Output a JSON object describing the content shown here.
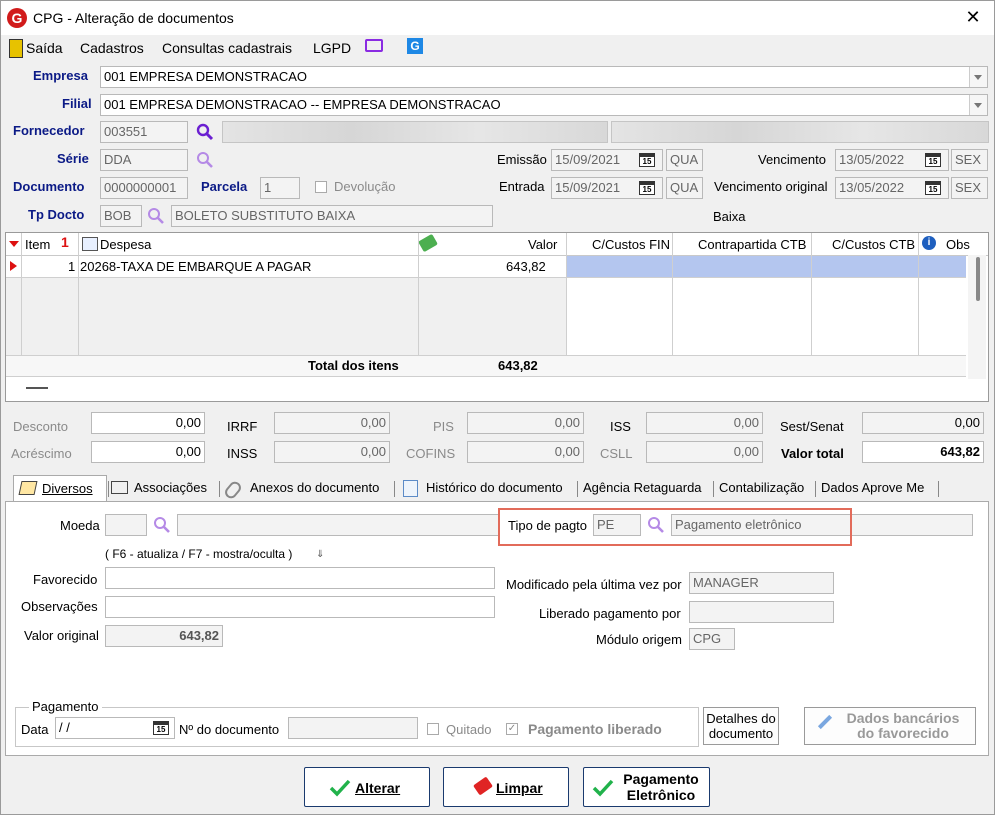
{
  "window": {
    "title": "CPG - Alteração de documentos",
    "logo_letter": "G"
  },
  "menu": {
    "items": [
      "Saída",
      "Cadastros",
      "Consultas cadastrais",
      "LGPD"
    ]
  },
  "header": {
    "empresa_label": "Empresa",
    "empresa_value": "001 EMPRESA DEMONSTRACAO",
    "filial_label": "Filial",
    "filial_value": "001 EMPRESA DEMONSTRACAO -- EMPRESA DEMONSTRACAO",
    "fornecedor_label": "Fornecedor",
    "fornecedor_value": "003551",
    "serie_label": "Série",
    "serie_value": "DDA",
    "documento_label": "Documento",
    "documento_value": "0000000001",
    "parcela_label": "Parcela",
    "parcela_value": "1",
    "devolucao_label": "Devolução",
    "tpdocto_label": "Tp Docto",
    "tpdocto_code": "BOB",
    "tpdocto_desc": "BOLETO SUBSTITUTO BAIXA",
    "emissao_label": "Emissão",
    "emissao_date": "15/09/2021",
    "emissao_day": "QUA",
    "entrada_label": "Entrada",
    "entrada_date": "15/09/2021",
    "entrada_day": "QUA",
    "vencimento_label": "Vencimento",
    "vencimento_date": "13/05/2022",
    "vencimento_day": "SEX",
    "vencorig_label": "Vencimento original",
    "vencorig_date": "13/05/2022",
    "vencorig_day": "SEX",
    "baixa_label": "Baixa",
    "cal_glyph": "15"
  },
  "grid": {
    "columns": [
      "Item",
      "Despesa",
      "Valor",
      "C/Custos FIN",
      "Contrapartida CTB",
      "C/Custos CTB",
      "Obs"
    ],
    "rows": [
      {
        "item": "1",
        "despesa": "20268-TAXA DE EMBARQUE A PAGAR",
        "valor": "643,82"
      }
    ],
    "total_label": "Total dos itens",
    "total_value": "643,82"
  },
  "totals": {
    "desconto_label": "Desconto",
    "desconto": "0,00",
    "acrescimo_label": "Acréscimo",
    "acrescimo": "0,00",
    "irrf_label": "IRRF",
    "irrf": "0,00",
    "inss_label": "INSS",
    "inss": "0,00",
    "pis_label": "PIS",
    "pis": "0,00",
    "cofins_label": "COFINS",
    "cofins": "0,00",
    "iss_label": "ISS",
    "iss": "0,00",
    "csll_label": "CSLL",
    "csll": "0,00",
    "sest_label": "Sest/Senat",
    "sest": "0,00",
    "valortotal_label": "Valor total",
    "valortotal": "643,82"
  },
  "tabs": [
    "Diversos",
    "Associações",
    "Anexos do documento",
    "Histórico do documento",
    "Agência Retaguarda",
    "Contabilização",
    "Dados Aprove Me"
  ],
  "diversos": {
    "moeda_label": "Moeda",
    "tipopagto_label": "Tipo de pagto",
    "tipopagto_code": "PE",
    "tipopagto_desc": "Pagamento eletrônico",
    "hint": "( F6 - atualiza / F7 - mostra/oculta )",
    "favorecido_label": "Favorecido",
    "observacoes_label": "Observações",
    "valororiginal_label": "Valor original",
    "valororiginal": "643,82",
    "modificado_label": "Modificado pela última vez por",
    "modificado_value": "MANAGER",
    "liberado_label": "Liberado pagamento por",
    "modulo_label": "Módulo origem",
    "modulo_value": "CPG",
    "pagamento_group": "Pagamento",
    "data_label": "Data",
    "data_value": "/ /",
    "ndoc_label": "Nº do documento",
    "quitado_label": "Quitado",
    "pagliberado_label": "Pagamento liberado",
    "detalhes_btn_l1": "Detalhes do",
    "detalhes_btn_l2": "documento",
    "dadosbanc_btn_l1": "Dados bancários",
    "dadosbanc_btn_l2": "do favorecido"
  },
  "footer": {
    "alterar": "Alterar",
    "limpar": "Limpar",
    "pagamento_l1": "Pagamento",
    "pagamento_l2": "Eletrônico"
  },
  "colors": {
    "label_blue": "#0b1a86",
    "accent_purple": "#9b30ff",
    "highlight": "#e26b5a",
    "row_select": "#b4c6ef"
  }
}
